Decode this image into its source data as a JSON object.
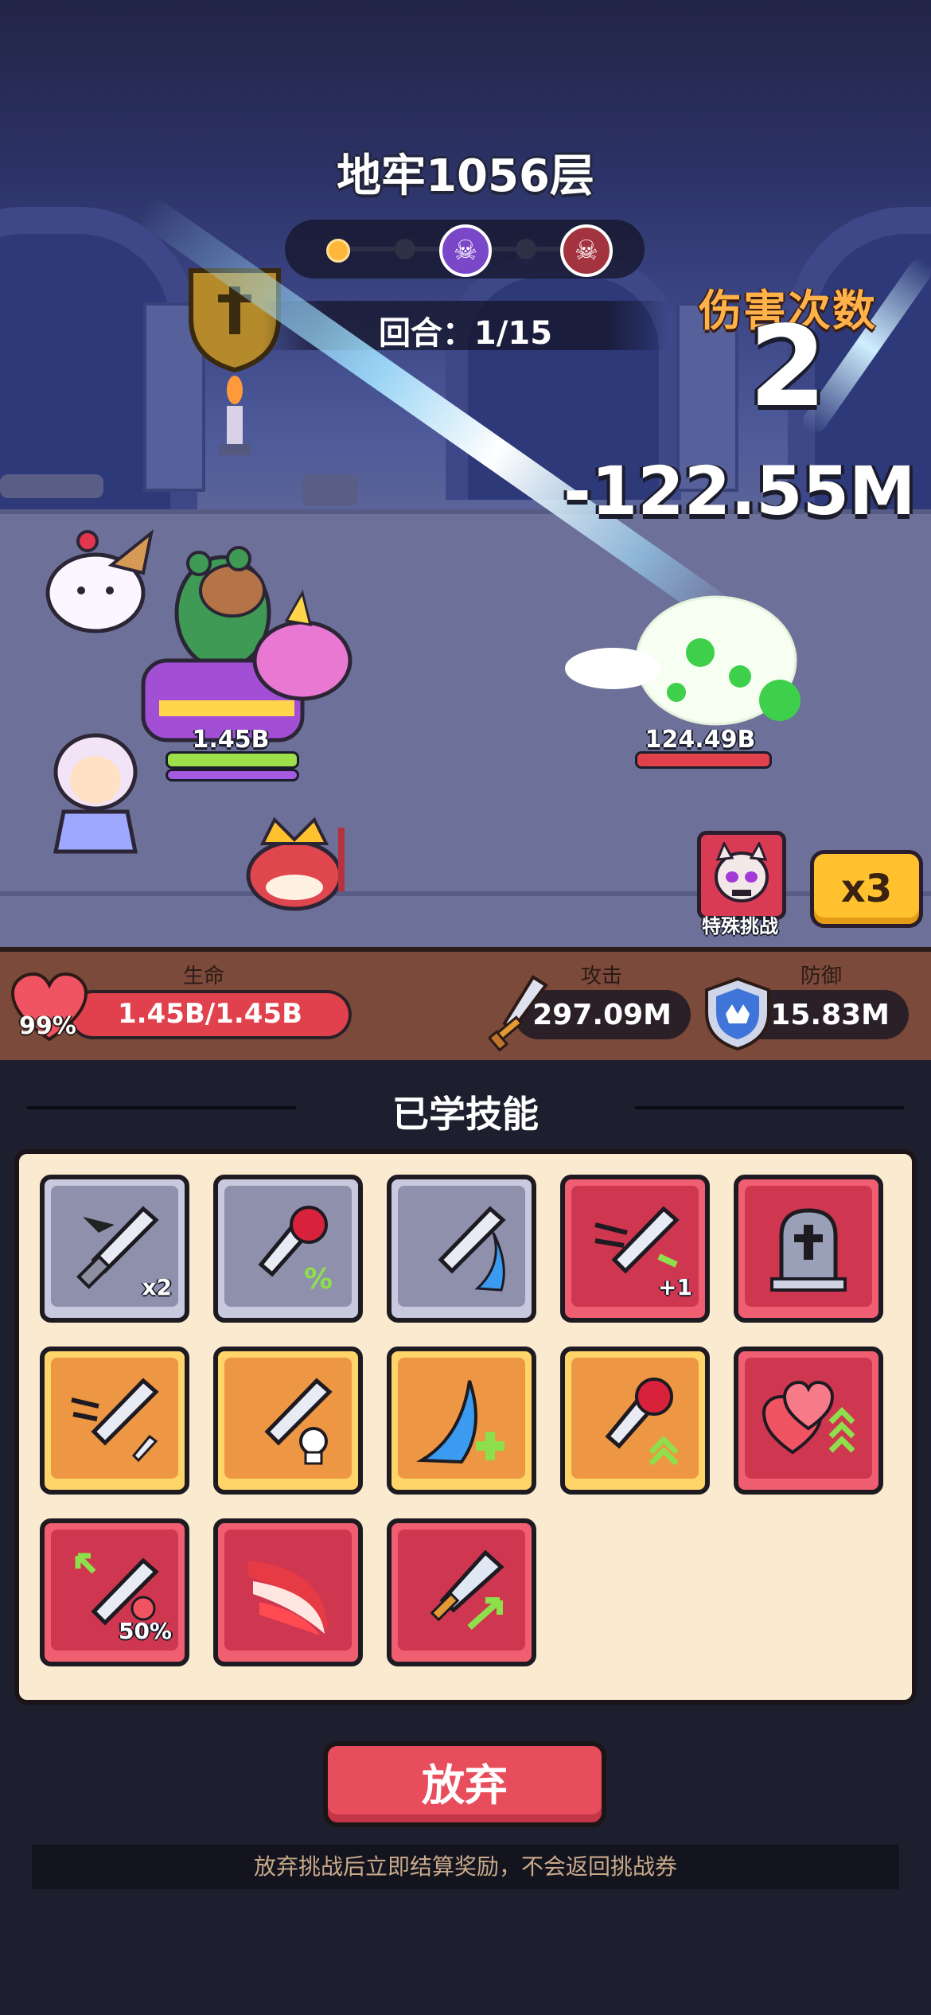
{
  "header": {
    "title": "地牢1056层",
    "round_text": "回合：1/15"
  },
  "combat": {
    "damage_label": "伤害次数",
    "damage_count": "2",
    "damage_number": "-122.55M",
    "player_hp_label": "1.45B",
    "enemy_hp_label": "124.49B"
  },
  "controls": {
    "special_challenge_label": "特殊挑战",
    "speed_label": "x3"
  },
  "stats": {
    "hp_label": "生命",
    "hp_percent": "99%",
    "hp_value": "1.45B/1.45B",
    "hp_fraction": 1.0,
    "attack_label": "攻击",
    "attack_value": "297.09M",
    "defense_label": "防御",
    "defense_value": "15.83M"
  },
  "skills": {
    "title": "已学技能",
    "items": [
      {
        "icon": "sword-double-icon",
        "badge": "x2",
        "frame": "grey"
      },
      {
        "icon": "sword-crit-percent-icon",
        "badge": "",
        "frame": "grey"
      },
      {
        "icon": "sword-wave-icon",
        "badge": "",
        "frame": "grey"
      },
      {
        "icon": "sword-speed-plus-icon",
        "badge": "+1",
        "frame": "red"
      },
      {
        "icon": "tombstone-icon",
        "badge": "",
        "frame": "red"
      },
      {
        "icon": "sword-dash-dagger-icon",
        "badge": "",
        "frame": "gold"
      },
      {
        "icon": "sword-skull-icon",
        "badge": "",
        "frame": "gold"
      },
      {
        "icon": "wave-heal-icon",
        "badge": "",
        "frame": "gold"
      },
      {
        "icon": "sword-crit-up-icon",
        "badge": "",
        "frame": "gold"
      },
      {
        "icon": "hearts-up-icon",
        "badge": "",
        "frame": "red"
      },
      {
        "icon": "sword-lifesteal-icon",
        "badge": "50%",
        "frame": "red"
      },
      {
        "icon": "red-claw-icon",
        "badge": "",
        "frame": "red"
      },
      {
        "icon": "sword-attack-up-icon",
        "badge": "",
        "frame": "red"
      }
    ]
  },
  "footer": {
    "give_up_label": "放弃",
    "notice": "放弃挑战后立即结算奖励，不会返回挑战券"
  },
  "colors": {
    "accent_red": "#e84d5b",
    "gold": "#ffc12e",
    "panel_bg": "#f9ead0"
  }
}
